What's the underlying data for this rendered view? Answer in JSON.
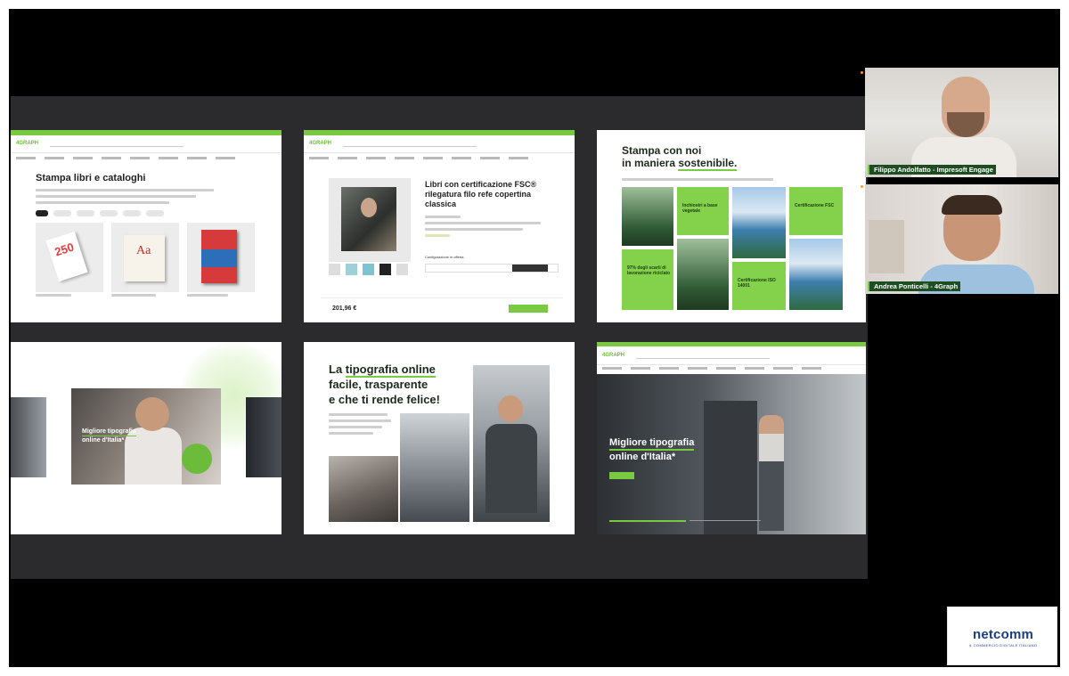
{
  "slides": {
    "catalog": {
      "logo": "4GRAPH",
      "title": "Stampa libri e cataloghi",
      "book_cover_text": "250",
      "book2_cover_text": "Aa"
    },
    "product": {
      "logo": "4GRAPH",
      "title": "Libri con certificazione FSC® rilegatura filo refe copertina classica",
      "config_label": "Configurazione in offerta",
      "price": "201,96 €"
    },
    "sustainable": {
      "title_line1": "Stampa con noi",
      "title_line2_pre": "in maniera ",
      "title_line2_highlight": "sostenibile.",
      "tiles": [
        "Inchiostri a base vegetale",
        "Certificazione FSC",
        "97% degli scarti di lavorazione riciclato",
        "Certificazione ISO 14001"
      ]
    },
    "carousel": {
      "caption_highlight": "Migliore tipografia",
      "caption_rest": "online d'Italia*"
    },
    "happy": {
      "line1_pre": "La ",
      "line1_highlight": "tipografia online",
      "line2": "facile, trasparente",
      "line3": "e che ti rende felice!"
    },
    "homepage": {
      "logo": "4GRAPH",
      "caption_highlight": "Migliore tipografia",
      "caption_rest": "online d'Italia*"
    }
  },
  "participants": [
    {
      "name": "Filippo Andolfatto - Impresoft Engage"
    },
    {
      "name": "Andrea Ponticelli - 4Graph"
    }
  ],
  "brand": {
    "name": "netcomm",
    "tagline": "IL COMMERCIO DIGITALE ITALIANO"
  },
  "colors": {
    "accent_green": "#7ac943",
    "label_bg": "#1e4d21",
    "brand_blue": "#1c3d83"
  }
}
